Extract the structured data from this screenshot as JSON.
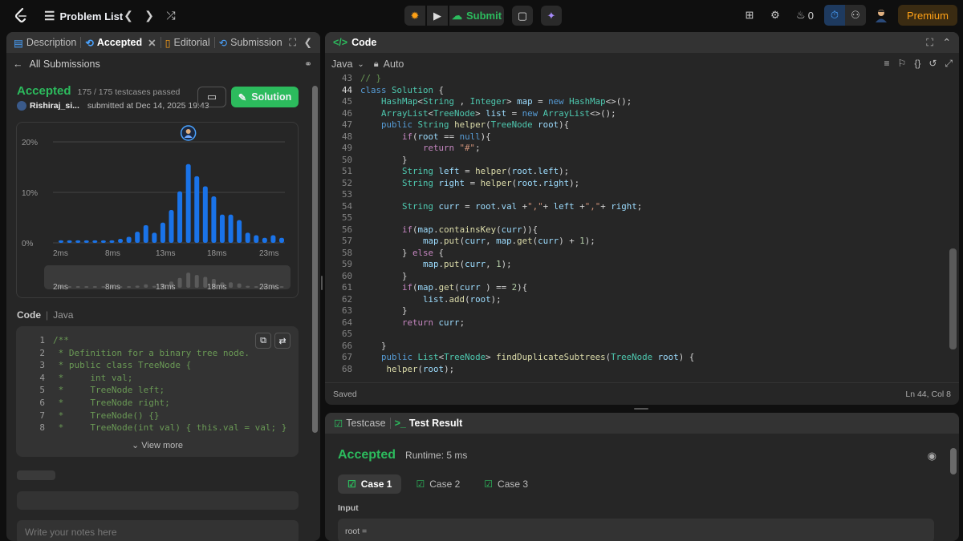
{
  "topbar": {
    "problem_list": "Problem List",
    "submit": "Submit",
    "streak": "0",
    "premium": "Premium"
  },
  "left": {
    "tabs": [
      "Description",
      "Accepted",
      "Editorial",
      "Submission"
    ],
    "all_submissions": "All Submissions",
    "status": "Accepted",
    "testcases": "175 / 175 testcases passed",
    "user": "Rishiraj_si...",
    "submitted": "submitted at Dec 14, 2025 19:43",
    "solution": "Solution",
    "chart_ylabels": [
      "20%",
      "10%",
      "0%"
    ],
    "chart_xlabels": [
      "2ms",
      "8ms",
      "13ms",
      "18ms",
      "23ms"
    ],
    "mini_labels": [
      "2ms",
      "8ms",
      "13ms",
      "18ms",
      "23ms"
    ],
    "code_label": "Code",
    "lang_label": "Java",
    "snippet": [
      {
        "n": "1",
        "t": "/**"
      },
      {
        "n": "2",
        "t": " * Definition for a binary tree node."
      },
      {
        "n": "3",
        "t": " * public class TreeNode {"
      },
      {
        "n": "4",
        "t": " *     int val;"
      },
      {
        "n": "5",
        "t": " *     TreeNode left;"
      },
      {
        "n": "6",
        "t": " *     TreeNode right;"
      },
      {
        "n": "7",
        "t": " *     TreeNode() {}"
      },
      {
        "n": "8",
        "t": " *     TreeNode(int val) { this.val = val; }"
      }
    ],
    "view_more": "View more",
    "notes_placeholder": "Write your notes here"
  },
  "chart_data": {
    "type": "bar",
    "title": "",
    "xlabel": "",
    "ylabel": "",
    "ylim": [
      0,
      20
    ],
    "x_tick_labels": [
      "2ms",
      "8ms",
      "13ms",
      "18ms",
      "23ms"
    ],
    "y_tick_labels": [
      "20%",
      "10%",
      "0%"
    ],
    "values": [
      0.5,
      0.5,
      0.5,
      0.5,
      0.5,
      0.5,
      0.5,
      0.8,
      1.2,
      2.2,
      3.5,
      2.0,
      4.0,
      6.5,
      10.2,
      15.6,
      13.2,
      11.2,
      9.2,
      5.6,
      5.6,
      4.5,
      2.0,
      1.5,
      1.0,
      1.5,
      1.0
    ],
    "highlight_index": 15,
    "color": "#1a73e8"
  },
  "code": {
    "title": "Code",
    "language": "Java",
    "auto": "Auto",
    "saved": "Saved",
    "position": "Ln 44, Col 8",
    "lines": [
      {
        "n": "43",
        "h": "<span class='cm'>// }</span>"
      },
      {
        "n": "44",
        "h": "<span class='kw'>class</span> <span class='ty'>Solution</span> {"
      },
      {
        "n": "45",
        "h": "    <span class='ty'>HashMap</span>&lt;<span class='ty'>String</span> , <span class='ty'>Integer</span>&gt; <span class='vr'>map</span> = <span class='kw'>new</span> <span class='ty'>HashMap</span>&lt;&gt;();"
      },
      {
        "n": "46",
        "h": "    <span class='ty'>ArrayList</span>&lt;<span class='ty'>TreeNode</span>&gt; <span class='vr'>list</span> = <span class='kw'>new</span> <span class='ty'>ArrayList</span>&lt;&gt;();"
      },
      {
        "n": "47",
        "h": "    <span class='kw'>public</span> <span class='ty'>String</span> <span class='fn'>helper</span>(<span class='ty'>TreeNode</span> <span class='vr'>root</span>){"
      },
      {
        "n": "48",
        "h": "        <span class='ky'>if</span>(<span class='vr'>root</span> == <span class='kw'>null</span>){"
      },
      {
        "n": "49",
        "h": "            <span class='ky'>return</span> <span class='st'>\"#\"</span>;"
      },
      {
        "n": "50",
        "h": "        }"
      },
      {
        "n": "51",
        "h": "        <span class='ty'>String</span> <span class='vr'>left</span> = <span class='fn'>helper</span>(<span class='vr'>root</span>.<span class='vr'>left</span>);"
      },
      {
        "n": "52",
        "h": "        <span class='ty'>String</span> <span class='vr'>right</span> = <span class='fn'>helper</span>(<span class='vr'>root</span>.<span class='vr'>right</span>);"
      },
      {
        "n": "53",
        "h": ""
      },
      {
        "n": "54",
        "h": "        <span class='ty'>String</span> <span class='vr'>curr</span> = <span class='vr'>root</span>.<span class='vr'>val</span> +<span class='st'>\",\"</span>+ <span class='vr'>left</span> +<span class='st'>\",\"</span>+ <span class='vr'>right</span>;"
      },
      {
        "n": "55",
        "h": ""
      },
      {
        "n": "56",
        "h": "        <span class='ky'>if</span>(<span class='vr'>map</span>.<span class='fn'>containsKey</span>(<span class='vr'>curr</span>)){"
      },
      {
        "n": "57",
        "h": "            <span class='vr'>map</span>.<span class='fn'>put</span>(<span class='vr'>curr</span>, <span class='vr'>map</span>.<span class='fn'>get</span>(<span class='vr'>curr</span>) + <span class='nm'>1</span>);"
      },
      {
        "n": "58",
        "h": "        } <span class='ky'>else</span> {"
      },
      {
        "n": "59",
        "h": "            <span class='vr'>map</span>.<span class='fn'>put</span>(<span class='vr'>curr</span>, <span class='nm'>1</span>);"
      },
      {
        "n": "60",
        "h": "        }"
      },
      {
        "n": "61",
        "h": "        <span class='ky'>if</span>(<span class='vr'>map</span>.<span class='fn'>get</span>(<span class='vr'>curr</span> ) == <span class='nm'>2</span>){"
      },
      {
        "n": "62",
        "h": "            <span class='vr'>list</span>.<span class='fn'>add</span>(<span class='vr'>root</span>);"
      },
      {
        "n": "63",
        "h": "        }"
      },
      {
        "n": "64",
        "h": "        <span class='ky'>return</span> <span class='vr'>curr</span>;"
      },
      {
        "n": "65",
        "h": ""
      },
      {
        "n": "66",
        "h": "    }"
      },
      {
        "n": "67",
        "h": "    <span class='kw'>public</span> <span class='ty'>List</span>&lt;<span class='ty'>TreeNode</span>&gt; <span class='fn'>findDuplicateSubtrees</span>(<span class='ty'>TreeNode</span> <span class='vr'>root</span>) {"
      },
      {
        "n": "68",
        "h": "     <span class='fn'>helper</span>(<span class='vr'>root</span>);"
      }
    ]
  },
  "result": {
    "tab_testcase": "Testcase",
    "tab_result": "Test Result",
    "status": "Accepted",
    "runtime": "Runtime: 5 ms",
    "cases": [
      "Case 1",
      "Case 2",
      "Case 3"
    ],
    "input_label": "Input",
    "root_label": "root ="
  }
}
